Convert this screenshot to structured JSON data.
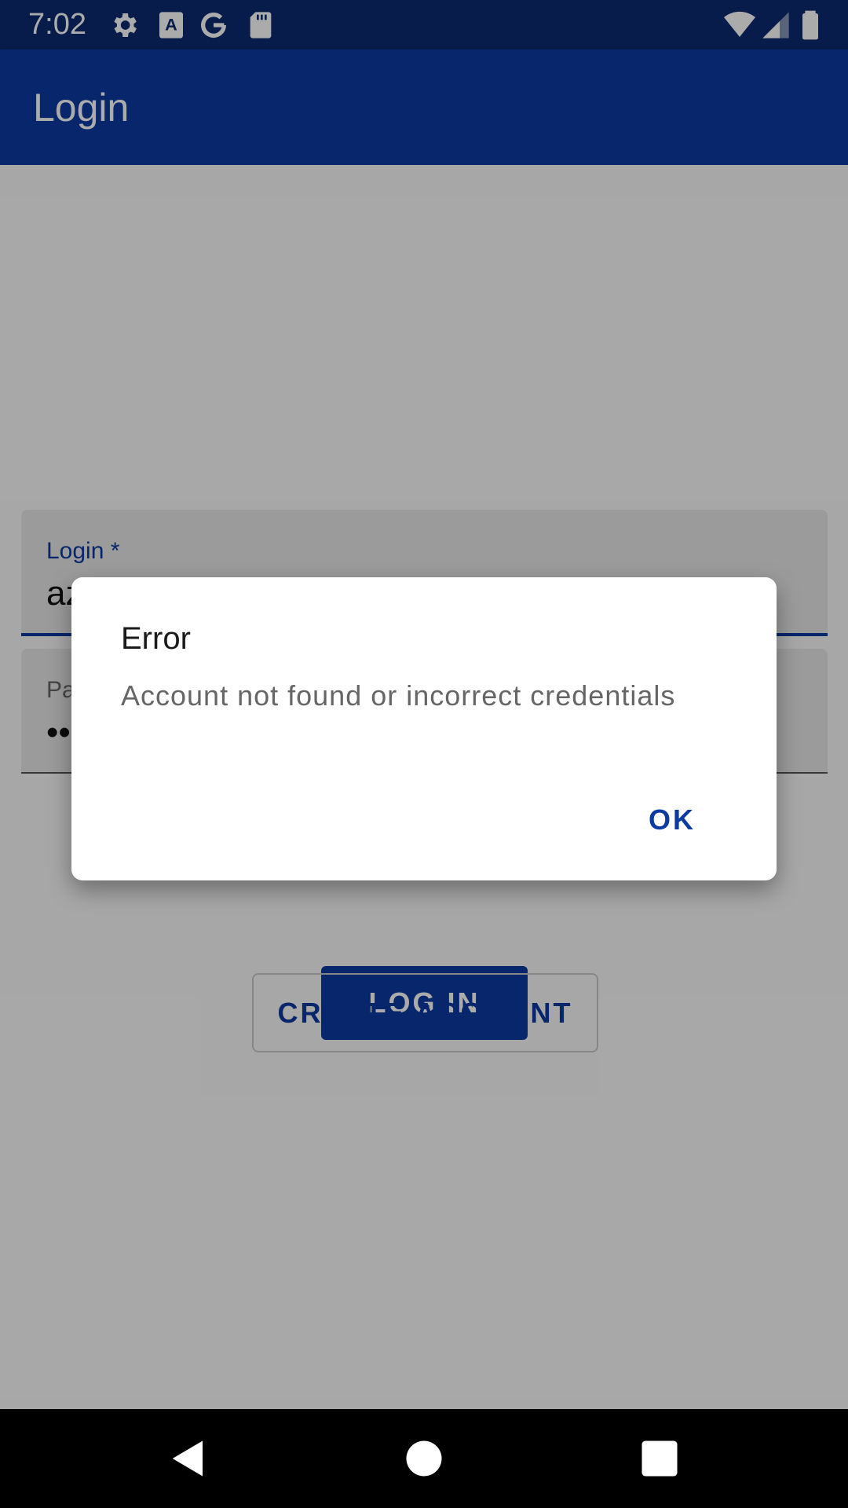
{
  "status_bar": {
    "time": "7:02",
    "left_icons": [
      "gear-icon",
      "font-a-icon",
      "google-g-icon",
      "sd-card-icon"
    ],
    "right_icons": [
      "wifi-icon",
      "signal-icon",
      "battery-icon"
    ]
  },
  "app_bar": {
    "title": "Login"
  },
  "form": {
    "login_label": "Login *",
    "login_value": "az",
    "password_label": "Pa",
    "password_value": "•••"
  },
  "buttons": {
    "log_in": "LOG IN",
    "create_account": "CREATE ACCOUNT"
  },
  "dialog": {
    "title": "Error",
    "message": "Account not found or incorrect credentials",
    "ok_label": "OK"
  },
  "nav_bar": {
    "buttons": [
      "back-icon",
      "home-icon",
      "recents-icon"
    ]
  },
  "colors": {
    "primary": "#0b3aa0",
    "status_bar": "#0b2a6f"
  }
}
